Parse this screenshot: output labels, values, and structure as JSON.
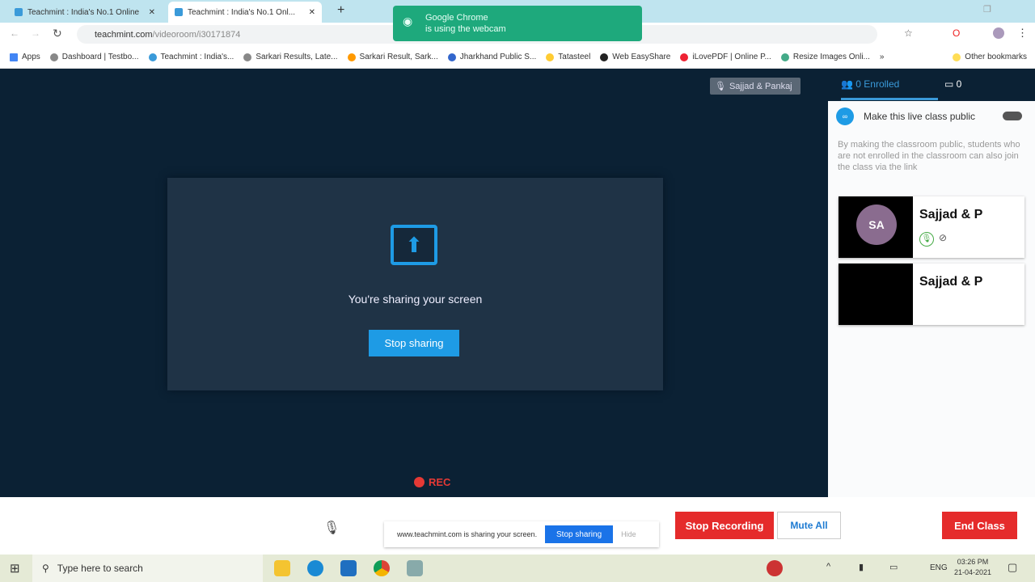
{
  "browser": {
    "tabs": [
      {
        "title": "Teachmint : India's No.1 Online"
      },
      {
        "title": "Teachmint : India's No.1 Onl..."
      }
    ],
    "url_host": "teachmint.com",
    "url_path": "/videoroom/i30171874",
    "bookmarks": [
      "Apps",
      "Dashboard | Testbo...",
      "Teachmint : India's...",
      "Sarkari Results, Late...",
      "Sarkari Result, Sark...",
      "Jharkhand Public S...",
      "Tatasteel",
      "Web EasyShare",
      "iLovePDF | Online P...",
      "Resize Images Onli..."
    ],
    "more": "»",
    "other_bookmarks": "Other bookmarks",
    "toast": {
      "line1": "Google Chrome",
      "line2": "is using the webcam"
    }
  },
  "main": {
    "presenter_tag": "Sajjad & Pankaj",
    "share_message": "You're sharing your screen",
    "stop_sharing": "Stop sharing",
    "rec": "REC"
  },
  "panel": {
    "enrolled": "0 Enrolled",
    "chat_count": "0",
    "public_label": "Make this live class public",
    "public_enabled": false,
    "public_desc": "By making the classroom public, students who are not enrolled in the classroom can also join the class via the link",
    "participants": [
      {
        "name": "Sajjad & P",
        "initials": "SA"
      },
      {
        "name": "Sajjad & P"
      }
    ]
  },
  "bottom": {
    "share_notice": "www.teachmint.com is sharing your screen.",
    "share_stop": "Stop sharing",
    "share_hide": "Hide",
    "stop_recording": "Stop Recording",
    "mute_all": "Mute All",
    "end_class": "End Class"
  },
  "taskbar": {
    "search_placeholder": "Type here to search",
    "lang": "ENG",
    "time": "03:26 PM",
    "date": "21-04-2021"
  },
  "colors": {
    "accent": "#1e9be5",
    "danger": "#e52b2b",
    "bg": "#0b2134"
  }
}
